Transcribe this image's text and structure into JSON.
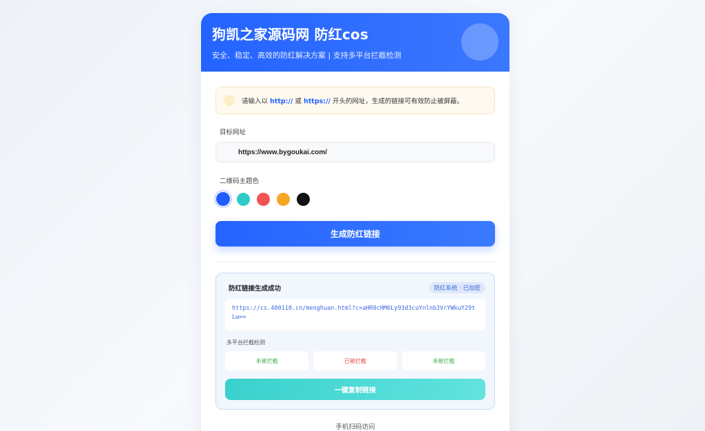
{
  "header": {
    "title": "狗凯之家源码网 防红cos",
    "subtitle": "安全、稳定、高效的防红解决方案 | 支持多平台拦截检测"
  },
  "notice": {
    "prefix": "请输入以 ",
    "http": "http://",
    "or": " 或 ",
    "https": "https://",
    "suffix": " 开头的网址，生成的链接可有效防止被屏蔽。"
  },
  "target": {
    "label": "目标网址",
    "value": "https://www.bygoukai.com/"
  },
  "theme": {
    "label": "二维码主题色",
    "colors": [
      "#1f5cff",
      "#2ecbc6",
      "#f25454",
      "#f5a623",
      "#111111"
    ]
  },
  "generate_label": "生成防红链接",
  "result": {
    "title": "防红链接生成成功",
    "badge": "防红系统 · 已加密",
    "link": "https://cs.400110.cn/menghuan.html?c=aHR0cHM6Ly93d3cuYnlnb3VrYWkuY29tLw==",
    "detect_label": "多平台拦截检测",
    "statuses": [
      "未被拦截",
      "已被拦截",
      "未被拦截"
    ],
    "copy_label": "一键复制链接"
  },
  "footer_label": "手机扫码访问"
}
